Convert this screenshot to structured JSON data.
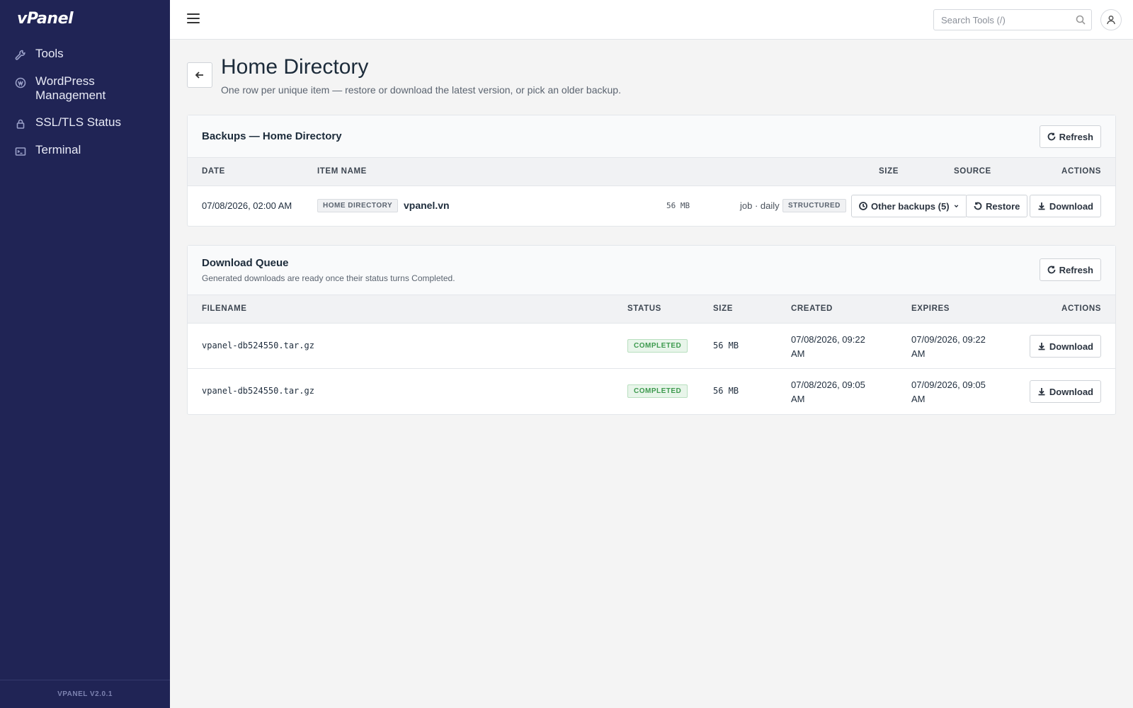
{
  "brand": {
    "logo": "vPanel",
    "footer_version": "VPANEL V2.0.1"
  },
  "sidebar": {
    "items": [
      {
        "label": "Tools",
        "icon": "wrench-icon"
      },
      {
        "label": "WordPress Management",
        "icon": "wordpress-icon"
      },
      {
        "label": "SSL/TLS Status",
        "icon": "lock-icon"
      },
      {
        "label": "Terminal",
        "icon": "terminal-icon"
      }
    ]
  },
  "topbar": {
    "search_placeholder": "Search Tools (/)"
  },
  "page": {
    "title": "Home Directory",
    "subtitle": "One row per unique item — restore or download the latest version, or pick an older backup."
  },
  "backups": {
    "title": "Backups — Home Directory",
    "refresh_label": "Refresh",
    "columns": [
      "DATE",
      "ITEM NAME",
      "SIZE",
      "SOURCE",
      "ACTIONS"
    ],
    "rows": [
      {
        "date": "07/08/2026, 02:00 AM",
        "type_badge": "HOME DIRECTORY",
        "name": "vpanel.vn",
        "size": "56 MB",
        "source": "job · daily",
        "source_badge": "STRUCTURED",
        "other_backups_label": "Other backups (5)",
        "restore_label": "Restore",
        "download_label": "Download"
      }
    ]
  },
  "queue": {
    "title": "Download Queue",
    "description": "Generated downloads are ready once their status turns Completed.",
    "refresh_label": "Refresh",
    "columns": [
      "FILENAME",
      "STATUS",
      "SIZE",
      "CREATED",
      "EXPIRES",
      "ACTIONS"
    ],
    "rows": [
      {
        "filename": "vpanel-db524550.tar.gz",
        "status": "COMPLETED",
        "size": "56 MB",
        "created_l1": "07/08/2026, 09:22",
        "created_l2": "AM",
        "expires_l1": "07/09/2026, 09:22",
        "expires_l2": "AM",
        "download_label": "Download"
      },
      {
        "filename": "vpanel-db524550.tar.gz",
        "status": "COMPLETED",
        "size": "56 MB",
        "created_l1": "07/08/2026, 09:05",
        "created_l2": "AM",
        "expires_l1": "07/09/2026, 09:05",
        "expires_l2": "AM",
        "download_label": "Download"
      }
    ]
  },
  "colors": {
    "sidebar_bg": "#202455",
    "status_green": "#3d9a4e",
    "page_bg": "#f4f4f4"
  }
}
